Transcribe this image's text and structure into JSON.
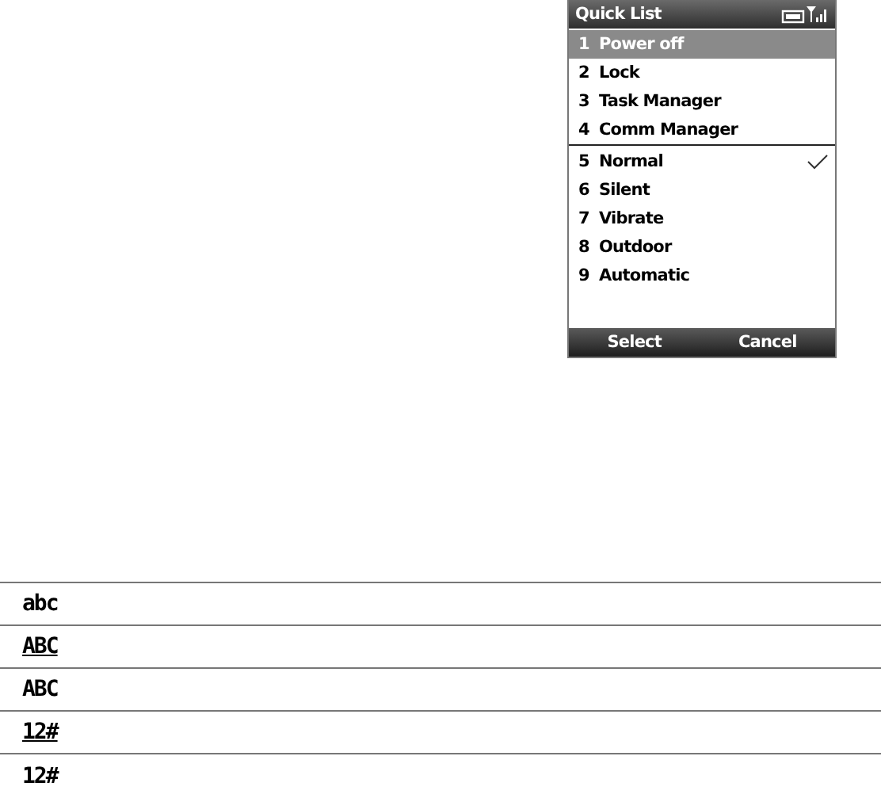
{
  "phone": {
    "title": "Quick List",
    "menu_groups": [
      [
        {
          "number": "1",
          "label": "Power off",
          "selected": true,
          "checked": false
        },
        {
          "number": "2",
          "label": "Lock",
          "selected": false,
          "checked": false
        },
        {
          "number": "3",
          "label": "Task Manager",
          "selected": false,
          "checked": false
        },
        {
          "number": "4",
          "label": "Comm Manager",
          "selected": false,
          "checked": false
        }
      ],
      [
        {
          "number": "5",
          "label": "Normal",
          "selected": false,
          "checked": true
        },
        {
          "number": "6",
          "label": "Silent",
          "selected": false,
          "checked": false
        },
        {
          "number": "7",
          "label": "Vibrate",
          "selected": false,
          "checked": false
        },
        {
          "number": "8",
          "label": "Outdoor",
          "selected": false,
          "checked": false
        },
        {
          "number": "9",
          "label": "Automatic",
          "selected": false,
          "checked": false
        }
      ]
    ],
    "soft_keys": [
      "Select",
      "Cancel"
    ]
  },
  "input_modes": [
    {
      "label": "abc",
      "underlined": false
    },
    {
      "label": "ABC",
      "underlined": true
    },
    {
      "label": "ABC",
      "underlined": false
    },
    {
      "label": "12#",
      "underlined": true
    },
    {
      "label": "12#",
      "underlined": false
    }
  ]
}
